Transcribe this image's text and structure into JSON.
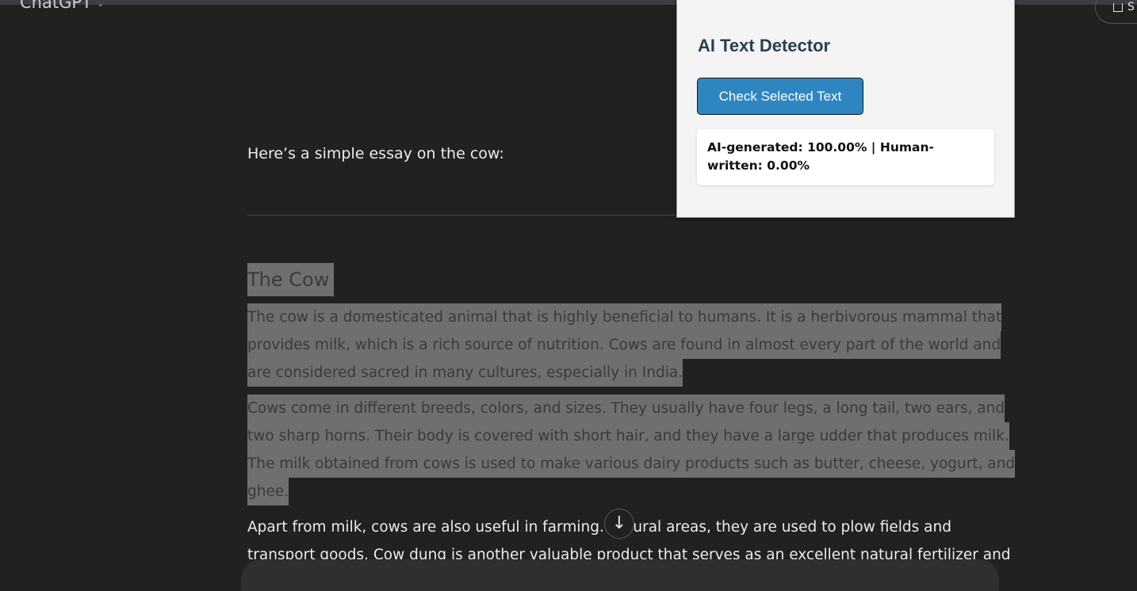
{
  "app": {
    "model_label": "ChatGPT",
    "share_label": "S"
  },
  "conversation": {
    "intro": "Here’s a simple essay on the cow:",
    "heading": "The Cow",
    "para1_lines": [
      "The cow is a domesticated animal that is highly beneficial to humans. It is a herbivorous mammal that",
      "provides milk, which is a rich source of nutrition. Cows are found in almost every part of the world and",
      "are considered sacred in many cultures, especially in India."
    ],
    "para2_lines": [
      "Cows come in different breeds, colors, and sizes. They usually have four legs, a long tail, two ears, and",
      "two sharp horns. Their body is covered with short hair, and they have a large udder that produces milk.",
      "The milk obtained from cows is used to make various dairy products such as butter, cheese, yogurt, and",
      "ghee."
    ],
    "para3_lines": [
      "Apart from milk, cows are also useful in farming. In rural areas, they are used to plow fields and",
      "transport goods. Cow dung is another valuable product that serves as an excellent natural fertilizer and"
    ]
  },
  "icons": {
    "scroll_down": "arrow-down-icon",
    "model_chevron": "chevron-down-icon"
  },
  "extension_popup": {
    "title": "AI Text Detector",
    "button_label": "Check Selected Text",
    "result_text": "AI-generated: 100.00% | Human-written: 0.00%"
  },
  "colors": {
    "background": "#212121",
    "selection": "#6f6f6f",
    "button": "#2e86c1",
    "popup_bg": "#f4f4f4"
  }
}
